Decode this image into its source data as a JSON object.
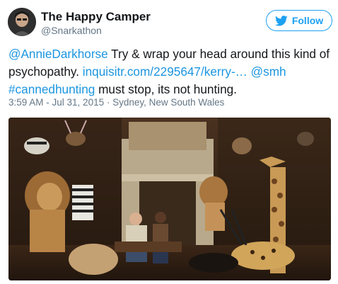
{
  "author": {
    "display_name": "The Happy Camper",
    "handle": "@Snarkathon"
  },
  "follow_button": {
    "label": "Follow"
  },
  "tweet": {
    "mention_1": "@AnnieDarkhorse",
    "text_1": " Try & wrap your head around this kind of psychopathy. ",
    "link": "inquisitr.com/2295647/kerry-…",
    "mention_2": "@smh",
    "hashtag": "#cannedhunting",
    "text_2": " must stop, its not hunting."
  },
  "meta": {
    "time": "3:59 AM",
    "separator_1": " - ",
    "date": "Jul 31, 2015",
    "separator_2": " · ",
    "location": "Sydney, New South Wales"
  },
  "colors": {
    "link": "#1b95e0",
    "follow": "#1da1f2",
    "meta": "#657786"
  },
  "icons": {
    "follow_icon": "twitter-bird-icon"
  }
}
